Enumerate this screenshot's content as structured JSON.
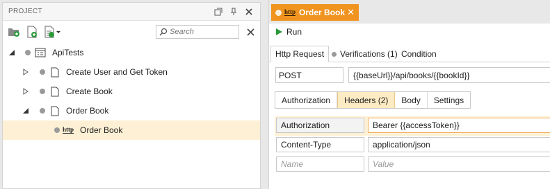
{
  "project_panel": {
    "title": "PROJECT",
    "search_placeholder": "Search",
    "tree": [
      {
        "label": "ApiTests"
      },
      {
        "label": "Create User and Get Token"
      },
      {
        "label": "Create Book"
      },
      {
        "label": "Order Book"
      },
      {
        "label": "Order Book",
        "icon_text": "http"
      }
    ]
  },
  "editor": {
    "tab": {
      "label": "Order Book",
      "icon_text": "http"
    },
    "run_label": "Run",
    "sub_tabs": [
      {
        "label": "Http Request"
      },
      {
        "label": "Verifications (1)"
      },
      {
        "label": "Condition"
      }
    ],
    "method": "POST",
    "url": "{{baseUrl}}/api/books/{{bookId}}",
    "request_tabs": [
      {
        "label": "Authorization"
      },
      {
        "label": "Headers (2)"
      },
      {
        "label": "Body"
      },
      {
        "label": "Settings"
      }
    ],
    "headers": [
      {
        "name": "Authorization",
        "value": "Bearer {{accessToken}}"
      },
      {
        "name": "Content-Type",
        "value": "application/json"
      }
    ],
    "new_header": {
      "name_placeholder": "Name",
      "value_placeholder": "Value"
    }
  },
  "colors": {
    "accent": "#f0931f",
    "selection": "#fdf0d4",
    "run": "#2a9a3a"
  }
}
